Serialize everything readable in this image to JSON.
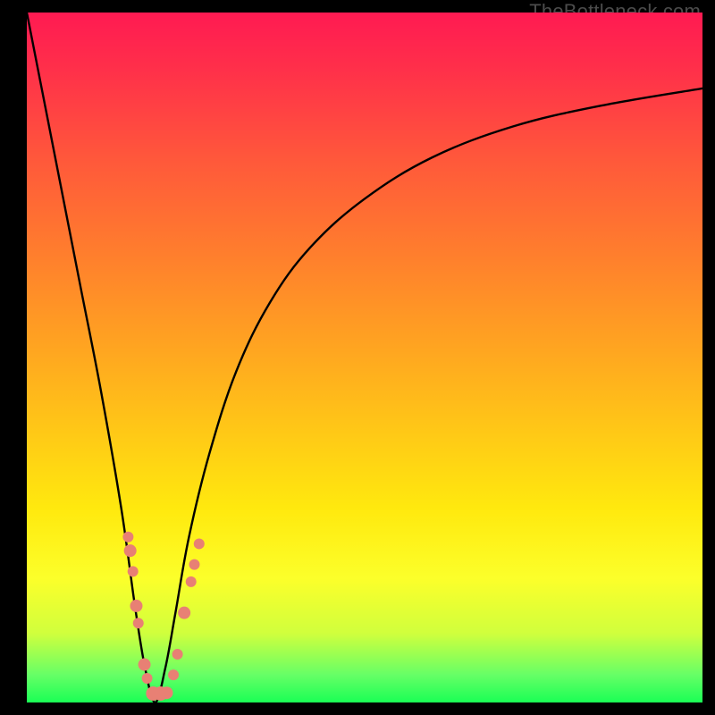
{
  "watermark": "TheBottleneck.com",
  "chart_data": {
    "type": "line",
    "title": "",
    "xlabel": "",
    "ylabel": "",
    "xlim": [
      0,
      100
    ],
    "ylim": [
      0,
      100
    ],
    "background_gradient": {
      "top": "#ff1a52",
      "mid1": "#ff7e2d",
      "mid2": "#ffe90e",
      "bottom": "#1aff55"
    },
    "series": [
      {
        "name": "bottleneck-curve",
        "comment": "V-shaped curve; y≈100 at x=0, dips to y≈0 near x≈19, rises asymptotically toward y≈90 at x=100",
        "x": [
          0,
          2,
          5,
          8,
          11,
          14,
          16,
          17.5,
          19,
          20.5,
          22,
          24,
          27,
          31,
          36,
          42,
          50,
          60,
          72,
          85,
          100
        ],
        "y": [
          100,
          90,
          75,
          60,
          45,
          28,
          14,
          5,
          0,
          5,
          13,
          24,
          36,
          48,
          58,
          66,
          73,
          79,
          83.5,
          86.5,
          89
        ]
      }
    ],
    "markers": {
      "name": "highlight-dots",
      "comment": "salmon-pink dots clustered along lower V portion",
      "color": "#e88074",
      "points": [
        {
          "x": 15.0,
          "y": 24.0,
          "r": 6
        },
        {
          "x": 15.3,
          "y": 22.0,
          "r": 7
        },
        {
          "x": 15.7,
          "y": 19.0,
          "r": 6
        },
        {
          "x": 16.2,
          "y": 14.0,
          "r": 7
        },
        {
          "x": 16.5,
          "y": 11.5,
          "r": 6
        },
        {
          "x": 17.4,
          "y": 5.5,
          "r": 7
        },
        {
          "x": 17.8,
          "y": 3.5,
          "r": 6
        },
        {
          "x": 18.7,
          "y": 1.3,
          "r": 8
        },
        {
          "x": 19.8,
          "y": 1.3,
          "r": 8
        },
        {
          "x": 20.7,
          "y": 1.4,
          "r": 7
        },
        {
          "x": 21.7,
          "y": 4.0,
          "r": 6
        },
        {
          "x": 22.3,
          "y": 7.0,
          "r": 6
        },
        {
          "x": 23.3,
          "y": 13.0,
          "r": 7
        },
        {
          "x": 24.3,
          "y": 17.5,
          "r": 6
        },
        {
          "x": 24.8,
          "y": 20.0,
          "r": 6
        },
        {
          "x": 25.5,
          "y": 23.0,
          "r": 6
        }
      ]
    }
  }
}
